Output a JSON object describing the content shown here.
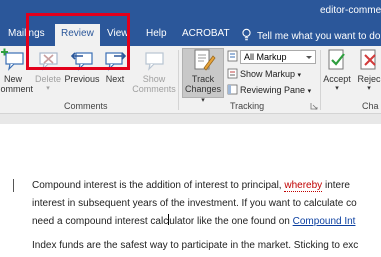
{
  "window": {
    "doc_name": "editor-comment"
  },
  "tabs": [
    {
      "label": "Mailings"
    },
    {
      "label": "Review",
      "active": true
    },
    {
      "label": "View"
    },
    {
      "label": "Help"
    },
    {
      "label": "ACROBAT"
    }
  ],
  "tell_me": {
    "text": "Tell me what you want to do",
    "icon": "lightbulb-icon"
  },
  "ribbon": {
    "new_comment": {
      "line1": "New",
      "line2": "Comment"
    },
    "delete": {
      "label": "Delete"
    },
    "previous": {
      "label": "Previous"
    },
    "next": {
      "label": "Next"
    },
    "show_comments": {
      "line1": "Show",
      "line2": "Comments"
    },
    "comments_group": "Comments",
    "track_changes": {
      "line1": "Track",
      "line2": "Changes"
    },
    "markup_select": "All Markup",
    "show_markup": "Show Markup",
    "reviewing_pane": "Reviewing Pane",
    "tracking_group": "Tracking",
    "accept": "Accept",
    "reject": "Rejec",
    "changes_group": "Cha"
  },
  "document": {
    "para1": {
      "l1_a": "Compound interest is the addition of interest to principal, ",
      "l1_flag": "whereby",
      "l1_b": " intere",
      "l2": "interest in subsequent years of the investment. If you want to calculate co",
      "l3_a": "need a compound interest calc",
      "l3_b": "ulator like the one found on ",
      "l3_link": "Compound Int"
    },
    "para2": "Index funds are the safest way to participate in the market. Sticking to exc"
  },
  "colors": {
    "accent": "#2b579a",
    "highlight": "#e3001b",
    "link": "#0b3fa0",
    "flag": "#c00000"
  }
}
